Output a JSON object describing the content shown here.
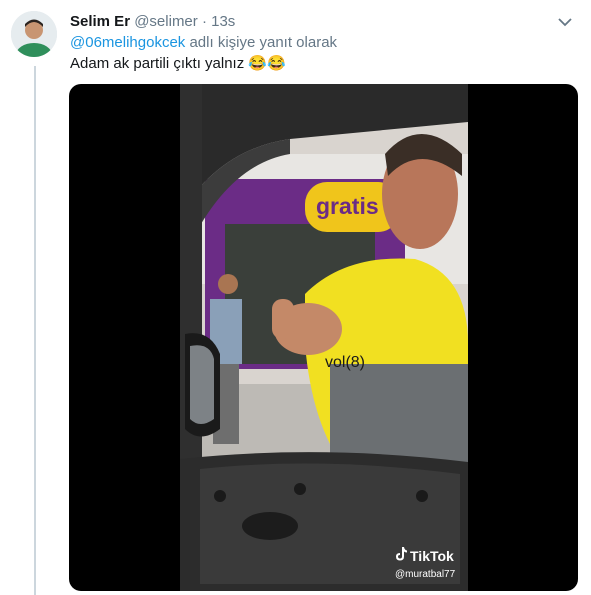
{
  "tweet": {
    "author_name": "Selim Er",
    "author_handle": "@selimer",
    "separator": "·",
    "time": "13s",
    "reply_mention": "@06melihgokcek",
    "reply_suffix": "adlı kişiye yanıt olarak",
    "text": "Adam ak partili çıktı yalnız",
    "emojis": "😂😂"
  },
  "media": {
    "sign_text": "gratis",
    "overlay_text": "vol(8)",
    "watermark_brand": "TikTok",
    "watermark_user": "@muratbal77"
  },
  "icons": {
    "caret": "chevron-down-icon",
    "tiktok": "tiktok-logo-icon"
  },
  "colors": {
    "link": "#1b95e0",
    "muted": "#657786",
    "text": "#14171a",
    "thread_line": "#ccd6dd"
  }
}
